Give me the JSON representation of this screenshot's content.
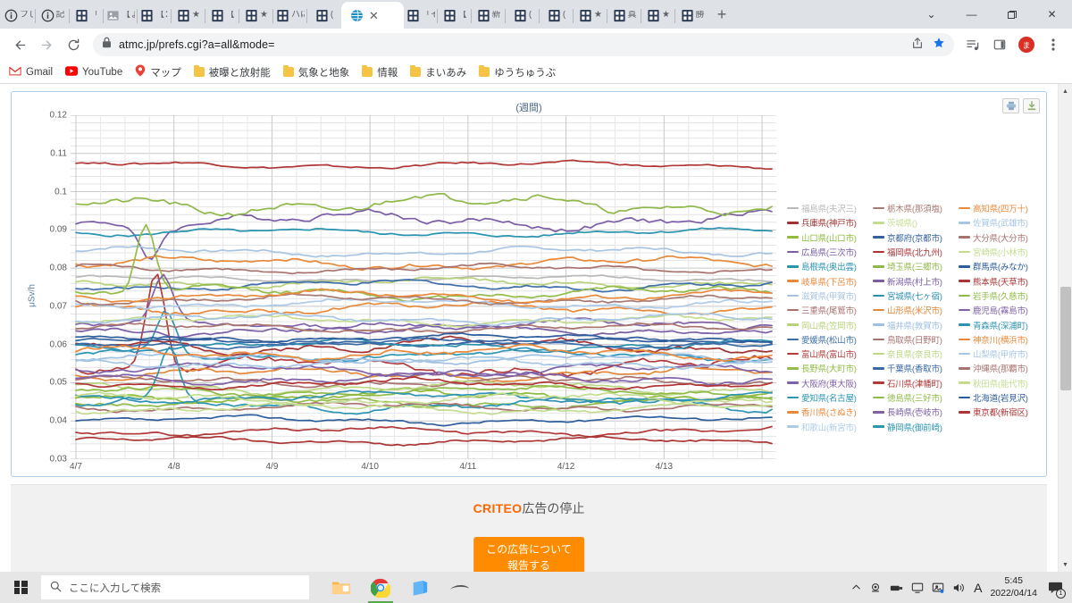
{
  "browser": {
    "tabs": [
      {
        "title": "フじ",
        "icon": "info-icon"
      },
      {
        "title": "記",
        "icon": "info-icon"
      },
      {
        "title": "「",
        "icon": "site-icon"
      },
      {
        "title": "【ょ",
        "icon": "image-icon"
      },
      {
        "title": "【：",
        "icon": "site-icon"
      },
      {
        "title": "★",
        "icon": "site-icon"
      },
      {
        "title": "【",
        "icon": "site-icon"
      },
      {
        "title": "★",
        "icon": "site-icon"
      },
      {
        "title": "ハに",
        "icon": "site-icon"
      },
      {
        "title": "(",
        "icon": "site-icon"
      },
      {
        "title": "",
        "icon": "globe-icon",
        "active": true
      },
      {
        "title": "「そ",
        "icon": "site-icon"
      },
      {
        "title": "【",
        "icon": "site-icon"
      },
      {
        "title": "新",
        "icon": "site-icon"
      },
      {
        "title": "(",
        "icon": "site-icon"
      },
      {
        "title": "(",
        "icon": "site-icon"
      },
      {
        "title": "★",
        "icon": "site-icon"
      },
      {
        "title": "真",
        "icon": "site-icon"
      },
      {
        "title": "★",
        "icon": "site-icon"
      },
      {
        "title": "勝",
        "icon": "site-icon"
      }
    ],
    "new_tab_label": "+",
    "close_tab_label": "✕",
    "window_controls": {
      "minimize": "—",
      "maximize": "▭",
      "close": "✕",
      "tab_search": "⌄"
    },
    "nav": {
      "back": "←",
      "forward": "→",
      "reload": "⟳"
    },
    "address": {
      "url": "atmc.jp/prefs.cgi?a=all&mode=",
      "lock_icon": "lock-icon"
    },
    "toolbar_icons": [
      "share-icon",
      "star-icon",
      "media-icon",
      "side-panel-icon",
      "profile-avatar",
      "menu-icon"
    ],
    "profile_initial": "ま",
    "bookmarks": [
      {
        "label": "Gmail",
        "icon": "gmail-icon"
      },
      {
        "label": "YouTube",
        "icon": "youtube-icon"
      },
      {
        "label": "マップ",
        "icon": "maps-icon"
      },
      {
        "label": "被曝と放射能",
        "icon": "folder-icon"
      },
      {
        "label": "気象と地象",
        "icon": "folder-icon"
      },
      {
        "label": "情報",
        "icon": "folder-icon"
      },
      {
        "label": "まいあみ",
        "icon": "folder-icon"
      },
      {
        "label": "ゆうちゅうぶ",
        "icon": "folder-icon"
      }
    ]
  },
  "chart_panel": {
    "print_icon": "printer-icon",
    "download_icon": "download-icon"
  },
  "ad": {
    "brand": "CRITEO",
    "title_suffix": "広告の停止",
    "button_line1": "この広告について",
    "button_line2": "報告する"
  },
  "taskbar": {
    "start_icon": "windows-logo-icon",
    "search_placeholder": "ここに入力して検索",
    "search_icon": "search-icon",
    "apps": [
      {
        "name": "file-explorer-icon"
      },
      {
        "name": "chrome-icon",
        "active": true
      },
      {
        "name": "sticky-notes-icon"
      },
      {
        "name": "pen-icon"
      }
    ],
    "tray_icons": [
      "chevron-up-icon",
      "camera-icon",
      "usb-icon",
      "monitor-icon",
      "display-icon",
      "volume-icon",
      "ime-icon"
    ],
    "ime_label": "A",
    "clock_time": "5:45",
    "clock_date": "2022/04/14",
    "notification_icon": "notification-icon",
    "notification_count": "1"
  },
  "chart_data": {
    "type": "line",
    "title": "(週間)",
    "xlabel": "",
    "ylabel": "μSv/h",
    "ylim": [
      0.03,
      0.12
    ],
    "yticks": [
      0.03,
      0.04,
      0.05,
      0.06,
      0.07,
      0.08,
      0.09,
      0.1,
      0.11,
      0.12
    ],
    "ytick_labels": [
      "0.03",
      "0.04",
      "0.05",
      "0.06",
      "0.07",
      "0.08",
      "0.09",
      "0.1",
      "0.11",
      "0.12"
    ],
    "xticks": [
      "4/7",
      "4/8",
      "4/9",
      "4/10",
      "4/11",
      "4/12",
      "4/13"
    ],
    "x_range": [
      "4/7",
      "4/14"
    ],
    "grid": true,
    "legend_position": "right",
    "legend_columns": 3,
    "series": [
      {
        "name": "福島県(夫沢三)",
        "color": "#b9b9b9",
        "baseline": 0.0772,
        "amp": 0.0006,
        "seed": 1,
        "spike": null
      },
      {
        "name": "兵庫県(神戸市)",
        "color": "#a03232",
        "baseline": 0.0598,
        "amp": 0.0016,
        "seed": 2,
        "spike": null
      },
      {
        "name": "山口県(山口市)",
        "color": "#8fbc3f",
        "baseline": 0.0465,
        "amp": 0.0012,
        "seed": 3,
        "spike": null
      },
      {
        "name": "広島県(三次市)",
        "color": "#7b5ea7",
        "baseline": 0.0925,
        "amp": 0.0018,
        "seed": 4,
        "spike": {
          "x": 0.105,
          "h": -0.0085
        }
      },
      {
        "name": "島根県(奥出雲)",
        "color": "#2a93b0",
        "baseline": 0.0893,
        "amp": 0.0008,
        "seed": 5,
        "spike": null
      },
      {
        "name": "岐阜県(下呂市)",
        "color": "#e8883a",
        "baseline": 0.0813,
        "amp": 0.0012,
        "seed": 6,
        "spike": null
      },
      {
        "name": "滋賀県(甲賀市)",
        "color": "#a8c4e0",
        "baseline": 0.0843,
        "amp": 0.0009,
        "seed": 7,
        "spike": null
      },
      {
        "name": "三重県(尾鷲市)",
        "color": "#a8736e",
        "baseline": 0.0798,
        "amp": 0.0009,
        "seed": 8,
        "spike": null
      },
      {
        "name": "岡山県(笠岡市)",
        "color": "#b7d27a",
        "baseline": 0.0762,
        "amp": 0.0011,
        "seed": 9,
        "spike": null
      },
      {
        "name": "愛媛県(松山市)",
        "color": "#3f6fa8",
        "baseline": 0.0755,
        "amp": 0.001,
        "seed": 10,
        "spike": null
      },
      {
        "name": "富山県(富山市)",
        "color": "#b23b3b",
        "baseline": 0.0542,
        "amp": 0.002,
        "seed": 11,
        "spike": {
          "x": 0.115,
          "h": 0.026
        }
      },
      {
        "name": "長野県(大町市)",
        "color": "#93bc4a",
        "baseline": 0.0735,
        "amp": 0.0013,
        "seed": 12,
        "spike": {
          "x": 0.1,
          "h": 0.018
        }
      },
      {
        "name": "大阪府(東大阪)",
        "color": "#7f62a8",
        "baseline": 0.065,
        "amp": 0.0012,
        "seed": 13,
        "spike": {
          "x": 0.125,
          "h": 0.012
        }
      },
      {
        "name": "愛知県(名古屋)",
        "color": "#2e95b5",
        "baseline": 0.0572,
        "amp": 0.0011,
        "seed": 14,
        "spike": {
          "x": 0.13,
          "h": 0.011
        }
      },
      {
        "name": "香川県(さぬき)",
        "color": "#e8893c",
        "baseline": 0.0695,
        "amp": 0.0012,
        "seed": 15,
        "spike": null
      },
      {
        "name": "和歌山(新宮市)",
        "color": "#aecbe8",
        "baseline": 0.0707,
        "amp": 0.001,
        "seed": 16,
        "spike": null
      },
      {
        "name": "栃木県(那須塩)",
        "color": "#a87a74",
        "baseline": 0.0718,
        "amp": 0.0009,
        "seed": 17,
        "spike": null
      },
      {
        "name": "茨城県()",
        "color": "#c5dd92",
        "baseline": 0.0663,
        "amp": 0.001,
        "seed": 18,
        "spike": null
      },
      {
        "name": "京都府(京都市)",
        "color": "#34609c",
        "baseline": 0.0607,
        "amp": 0.0008,
        "seed": 19,
        "spike": null
      },
      {
        "name": "福岡県(北九州)",
        "color": "#b03535",
        "baseline": 0.107,
        "amp": 0.0007,
        "seed": 20,
        "spike": null
      },
      {
        "name": "埼玉県(三郷市)",
        "color": "#8fb84a",
        "baseline": 0.0968,
        "amp": 0.002,
        "seed": 21,
        "spike": null
      },
      {
        "name": "新潟県(村上市)",
        "color": "#7a5ea5",
        "baseline": 0.064,
        "amp": 0.0012,
        "seed": 22,
        "spike": null
      },
      {
        "name": "宮城県(七ヶ宿)",
        "color": "#2d8fb0",
        "baseline": 0.0597,
        "amp": 0.0011,
        "seed": 23,
        "spike": null
      },
      {
        "name": "山形県(米沢市)",
        "color": "#e2883a",
        "baseline": 0.0523,
        "amp": 0.0013,
        "seed": 24,
        "spike": null
      },
      {
        "name": "福井県(敦賀市)",
        "color": "#9fc0e2",
        "baseline": 0.0563,
        "amp": 0.001,
        "seed": 25,
        "spike": null
      },
      {
        "name": "鳥取県(日野町)",
        "color": "#a8736e",
        "baseline": 0.0503,
        "amp": 0.0011,
        "seed": 26,
        "spike": null
      },
      {
        "name": "奈良県(奈良市)",
        "color": "#bcd684",
        "baseline": 0.0487,
        "amp": 0.0012,
        "seed": 27,
        "spike": null
      },
      {
        "name": "千葉県(香取市)",
        "color": "#3a6aa5",
        "baseline": 0.0603,
        "amp": 0.0009,
        "seed": 28,
        "spike": null
      },
      {
        "name": "石川県(津幡町)",
        "color": "#b03a3a",
        "baseline": 0.0373,
        "amp": 0.0009,
        "seed": 29,
        "spike": null
      },
      {
        "name": "徳島県(三好市)",
        "color": "#92bb4d",
        "baseline": 0.0447,
        "amp": 0.0011,
        "seed": 30,
        "spike": null
      },
      {
        "name": "長崎県(壱岐市)",
        "color": "#7f62a5",
        "baseline": 0.0533,
        "amp": 0.0012,
        "seed": 31,
        "spike": null
      },
      {
        "name": "静岡県(御前崎)",
        "color": "#2e95b3",
        "baseline": 0.0443,
        "amp": 0.0014,
        "seed": 32,
        "spike": {
          "x": 0.135,
          "h": 0.013
        }
      },
      {
        "name": "高知県(四万十)",
        "color": "#e8893c",
        "baseline": 0.0578,
        "amp": 0.0013,
        "seed": 33,
        "spike": null
      },
      {
        "name": "佐賀県(武雄市)",
        "color": "#a6c6e4",
        "baseline": 0.0553,
        "amp": 0.001,
        "seed": 34,
        "spike": null
      },
      {
        "name": "大分県(大分市)",
        "color": "#a8736e",
        "baseline": 0.0437,
        "amp": 0.0009,
        "seed": 35,
        "spike": null
      },
      {
        "name": "宮崎県(小林市)",
        "color": "#c3dc90",
        "baseline": 0.0432,
        "amp": 0.001,
        "seed": 36,
        "spike": null
      },
      {
        "name": "群馬県(みなか)",
        "color": "#2e5d9c",
        "baseline": 0.0402,
        "amp": 0.0008,
        "seed": 37,
        "spike": null
      },
      {
        "name": "熊本県(天草市)",
        "color": "#a93434",
        "baseline": 0.0348,
        "amp": 0.0008,
        "seed": 38,
        "spike": null
      },
      {
        "name": "岩手県(久慈市)",
        "color": "#8fba48",
        "baseline": 0.0477,
        "amp": 0.0011,
        "seed": 39,
        "spike": null
      },
      {
        "name": "鹿児島(霧島市)",
        "color": "#7f62a8",
        "baseline": 0.0513,
        "amp": 0.0012,
        "seed": 40,
        "spike": null
      },
      {
        "name": "青森県(深浦町)",
        "color": "#2e93b2",
        "baseline": 0.0463,
        "amp": 0.0011,
        "seed": 41,
        "spike": null
      },
      {
        "name": "神奈川(横浜市)",
        "color": "#e8893c",
        "baseline": 0.0727,
        "amp": 0.0011,
        "seed": 42,
        "spike": null
      },
      {
        "name": "山梨県(甲府市)",
        "color": "#a6c6e4",
        "baseline": 0.0667,
        "amp": 0.001,
        "seed": 43,
        "spike": null
      },
      {
        "name": "沖縄県(那覇市)",
        "color": "#a8736e",
        "baseline": 0.0643,
        "amp": 0.0009,
        "seed": 44,
        "spike": null
      },
      {
        "name": "秋田県(能代市)",
        "color": "#c3dc90",
        "baseline": 0.0457,
        "amp": 0.0012,
        "seed": 45,
        "spike": null
      },
      {
        "name": "北海道(岩見沢)",
        "color": "#2e5d9c",
        "baseline": 0.0617,
        "amp": 0.0008,
        "seed": 46,
        "spike": null
      },
      {
        "name": "東京都(新宿区)",
        "color": "#b03434",
        "baseline": 0.0497,
        "amp": 0.001,
        "seed": 47,
        "spike": null
      }
    ]
  }
}
